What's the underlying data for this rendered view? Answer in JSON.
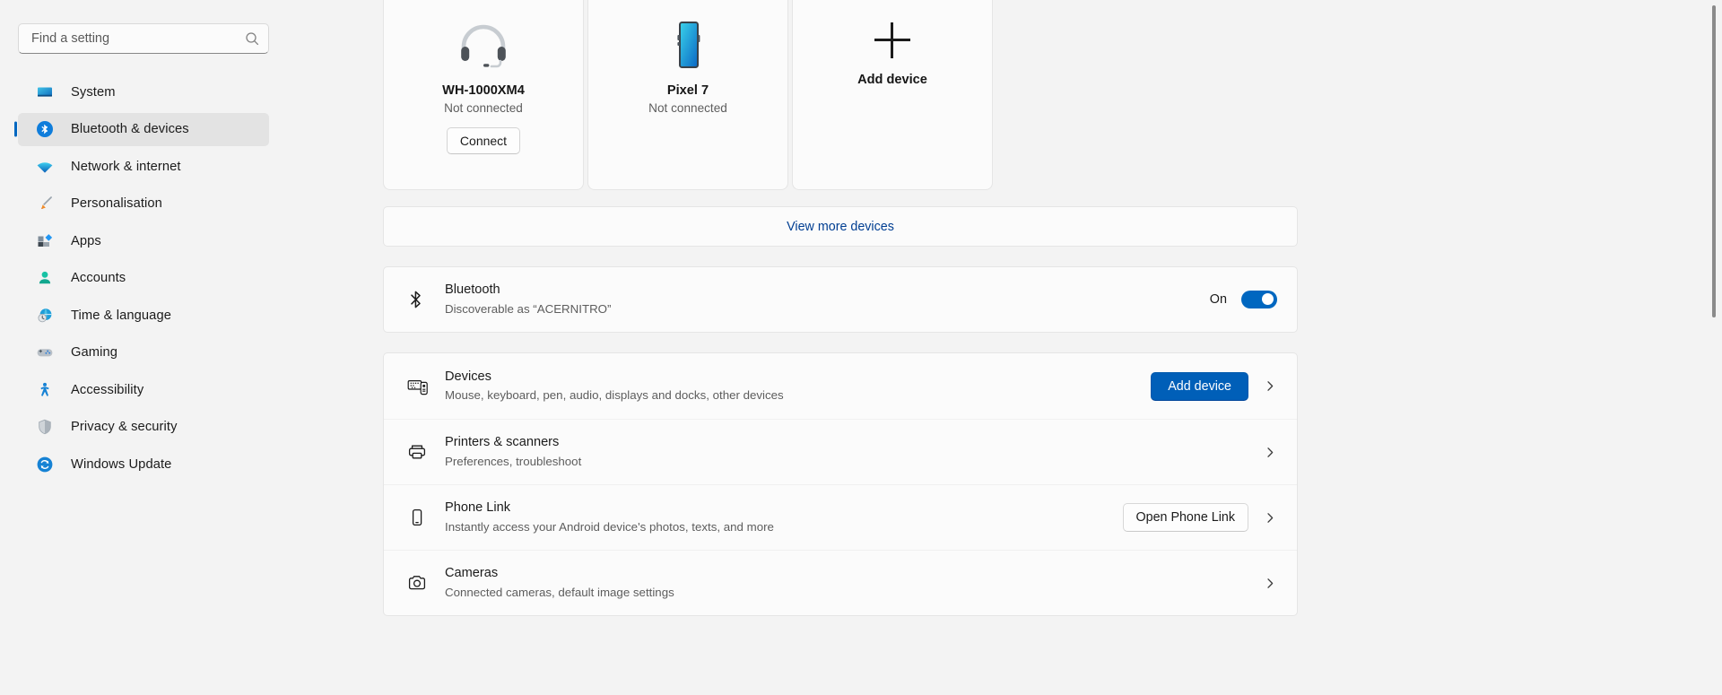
{
  "search": {
    "placeholder": "Find a setting",
    "value": "",
    "icon": "search-icon"
  },
  "sidebar": {
    "items": [
      {
        "label": "System",
        "icon": "monitor-icon",
        "active": false
      },
      {
        "label": "Bluetooth & devices",
        "icon": "bluetooth-icon",
        "active": true
      },
      {
        "label": "Network & internet",
        "icon": "wifi-icon",
        "active": false
      },
      {
        "label": "Personalisation",
        "icon": "paintbrush-icon",
        "active": false
      },
      {
        "label": "Apps",
        "icon": "apps-icon",
        "active": false
      },
      {
        "label": "Accounts",
        "icon": "person-icon",
        "active": false
      },
      {
        "label": "Time & language",
        "icon": "globe-clock-icon",
        "active": false
      },
      {
        "label": "Gaming",
        "icon": "gamepad-icon",
        "active": false
      },
      {
        "label": "Accessibility",
        "icon": "accessibility-icon",
        "active": false
      },
      {
        "label": "Privacy & security",
        "icon": "shield-icon",
        "active": false
      },
      {
        "label": "Windows Update",
        "icon": "update-icon",
        "active": false
      }
    ]
  },
  "devices": {
    "cards": [
      {
        "name": "WH-1000XM4",
        "status": "Not connected",
        "action_label": "Connect",
        "icon": "headphones-icon",
        "overflow_icon": "more-options-icon"
      },
      {
        "name": "Pixel 7",
        "status": "Not connected",
        "action_label": "",
        "icon": "smartphone-icon",
        "overflow_icon": "more-options-icon"
      }
    ],
    "add_device_card": {
      "label": "Add device",
      "icon": "plus-icon"
    },
    "view_more_label": "View more devices"
  },
  "bluetooth": {
    "title": "Bluetooth",
    "subtitle": "Discoverable as “ACERNITRO”",
    "toggle_state": "On",
    "icon": "bluetooth-icon"
  },
  "settings_rows": [
    {
      "title": "Devices",
      "subtitle": "Mouse, keyboard, pen, audio, displays and docks, other devices",
      "icon": "devices-icon",
      "button": "Add device",
      "button_style": "primary",
      "chevron": "chevron-right-icon"
    },
    {
      "title": "Printers & scanners",
      "subtitle": "Preferences, troubleshoot",
      "icon": "printer-icon",
      "button": "",
      "button_style": "",
      "chevron": "chevron-right-icon"
    },
    {
      "title": "Phone Link",
      "subtitle": "Instantly access your Android device's photos, texts, and more",
      "icon": "phone-icon",
      "button": "Open Phone Link",
      "button_style": "secondary",
      "chevron": "chevron-right-icon"
    },
    {
      "title": "Cameras",
      "subtitle": "Connected cameras, default image settings",
      "icon": "camera-icon",
      "button": "",
      "button_style": "",
      "chevron": "chevron-right-icon"
    }
  ],
  "colors": {
    "accent": "#005fb8",
    "link": "#003e92",
    "toggle_on": "#0067c0",
    "page_bg": "#f3f3f3",
    "card_bg": "#fbfbfb"
  }
}
